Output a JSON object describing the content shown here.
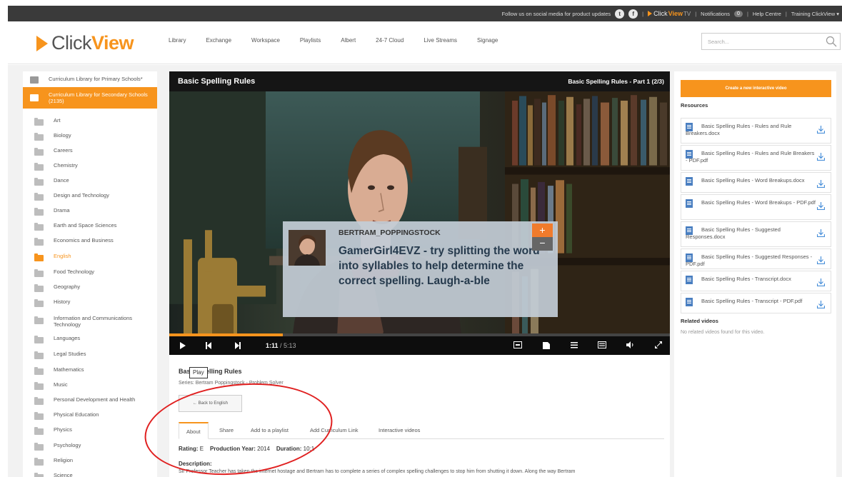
{
  "topbar": {
    "follow_text": "Follow us on social media for product updates",
    "tv_brand_click": "Click",
    "tv_brand_view": "View",
    "tv_brand_tv": "TV",
    "notifications_label": "Notifications",
    "notifications_count": "0",
    "help_centre": "Help Centre",
    "training": "Training ClickView ▾"
  },
  "header": {
    "logo_click": "Click",
    "logo_view": "View",
    "nav": [
      "Library",
      "Exchange",
      "Workspace",
      "Playlists",
      "Albert",
      "24-7 Cloud",
      "Live Streams",
      "Signage"
    ],
    "search_placeholder": "Search..."
  },
  "sidebar": {
    "libraries": [
      {
        "label": "Curriculum Library for Primary Schools*"
      },
      {
        "label": "Curriculum Library for Secondary Schools (2135)"
      }
    ],
    "subjects": [
      "Art",
      "Biology",
      "Careers",
      "Chemistry",
      "Dance",
      "Design and Technology",
      "Drama",
      "Earth and Space Sciences",
      "Economics and Business",
      "English",
      "Food Technology",
      "Geography",
      "History",
      "Information and Communications Technology",
      "Languages",
      "Legal Studies",
      "Mathematics",
      "Music",
      "Personal Development and Health",
      "Physical Education",
      "Physics",
      "Psychology",
      "Religion",
      "Science"
    ],
    "active_subject": "English"
  },
  "player": {
    "title": "Basic Spelling Rules",
    "episode": "Basic Spelling Rules - Part 1 (2/3)",
    "comment_user": "BERTRAM_POPPINGSTOCK",
    "comment_text": "GamerGirl4EVZ - try splitting the word into syllables to help determine the correct spelling. Laugh-a-ble",
    "plus": "+",
    "minus": "−",
    "time_current": "1:11",
    "time_total": "/ 5:13",
    "progress": 0.227
  },
  "info": {
    "video_title": "Basic Spelling Rules",
    "series": "Series: Bertram Poppingstock - Problem Solver",
    "back_button": "← Back to English",
    "tooltip": "Play",
    "tabs": [
      "About",
      "Share",
      "Add to a playlist",
      "Add Curriculum Link",
      "Interactive videos"
    ],
    "rating_label": "Rating:",
    "rating_value": "E",
    "year_label": "Production Year:",
    "year_value": "2014",
    "duration_label": "Duration:",
    "duration_value": "10:1",
    "description_label": "Description:",
    "description_text": "Sir Professor Teacher has taken the internet hostage and Bertram has to complete a series of complex spelling challenges to stop him from shutting it down.  Along the way Bertram"
  },
  "right": {
    "create_button": "Create a new interactive video",
    "resources_heading": "Resources",
    "resources": [
      "Basic Spelling Rules - Rules and Rule Breakers.docx",
      "Basic Spelling Rules - Rules and Rule Breakers - PDF.pdf",
      "Basic Spelling Rules - Word Breakups.docx",
      "Basic Spelling Rules - Word Breakups - PDF.pdf",
      "Basic Spelling Rules - Suggested Responses.docx",
      "Basic Spelling Rules - Suggested Responses - PDF.pdf",
      "Basic Spelling Rules - Transcript.docx",
      "Basic Spelling Rules - Transcript - PDF.pdf"
    ],
    "related_heading": "Related videos",
    "related_empty": "No related videos found for this video."
  },
  "colors": {
    "accent": "#f7941d",
    "annotation": "#e02020",
    "topbar": "#3a3a3a"
  }
}
